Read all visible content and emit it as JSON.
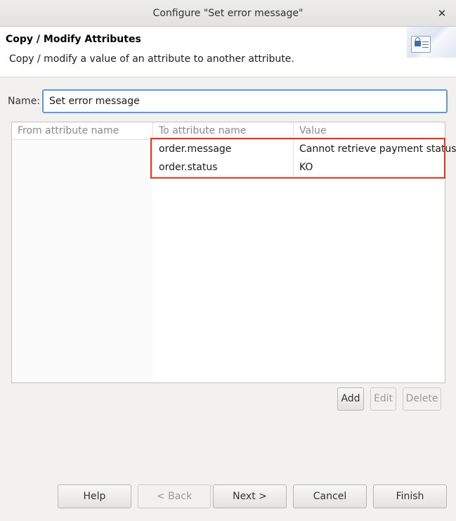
{
  "window": {
    "title": "Configure \"Set error message\"",
    "close_glyph": "✕"
  },
  "header": {
    "title": "Copy / Modify Attributes",
    "description": "Copy / modify a value of an attribute to another attribute.",
    "icon": "attributes-icon"
  },
  "form": {
    "name_label": "Name:",
    "name_value": "Set error message"
  },
  "table": {
    "columns": [
      "From attribute name",
      "To attribute name",
      "Value"
    ],
    "rows": [
      {
        "from": "",
        "to": "order.message",
        "value": "Cannot retrieve payment status"
      },
      {
        "from": "",
        "to": "order.status",
        "value": "KO"
      }
    ],
    "highlight_color": "#e8341c"
  },
  "table_buttons": {
    "add": "Add",
    "edit": "Edit",
    "delete": "Delete"
  },
  "footer_buttons": {
    "help": "Help",
    "back": "< Back",
    "next": "Next >",
    "cancel": "Cancel",
    "finish": "Finish"
  }
}
